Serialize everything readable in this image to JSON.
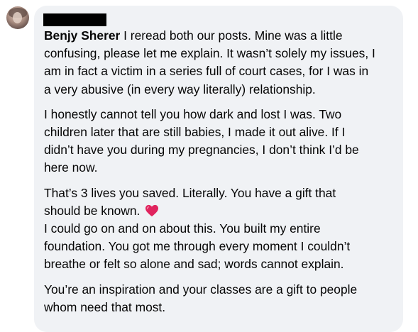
{
  "comment": {
    "author": "Benjy Sherer",
    "paragraphs": [
      [
        "I reread both our posts. Mine was a little",
        "confusing, please let me explain. It wasn’t solely my issues, I",
        "am in fact a victim in a series full of court cases, for I was in",
        "a very abusive (in every way literally) relationship."
      ],
      [
        "I honestly cannot tell you how dark and lost I was. Two",
        "children later that are still babies, I made it out alive. If I",
        "didn’t have you during my pregnancies, I don’t think I’d be",
        "here now."
      ],
      [
        "That’s 3 lives you saved. Literally. You have a gift that",
        "should be known.",
        "I could go on and on about this. You built my entire",
        "foundation. You got me through every moment I couldn’t",
        "breathe or felt so alone and sad; words cannot explain."
      ],
      [
        "You’re an inspiration and your classes are a gift to people",
        "whom need that most."
      ]
    ],
    "emoji": "heart-icon",
    "emoji_color": "#e0245e"
  },
  "colors": {
    "bubble": "#f0f2f5",
    "text": "#050505",
    "redaction": "#000000"
  }
}
